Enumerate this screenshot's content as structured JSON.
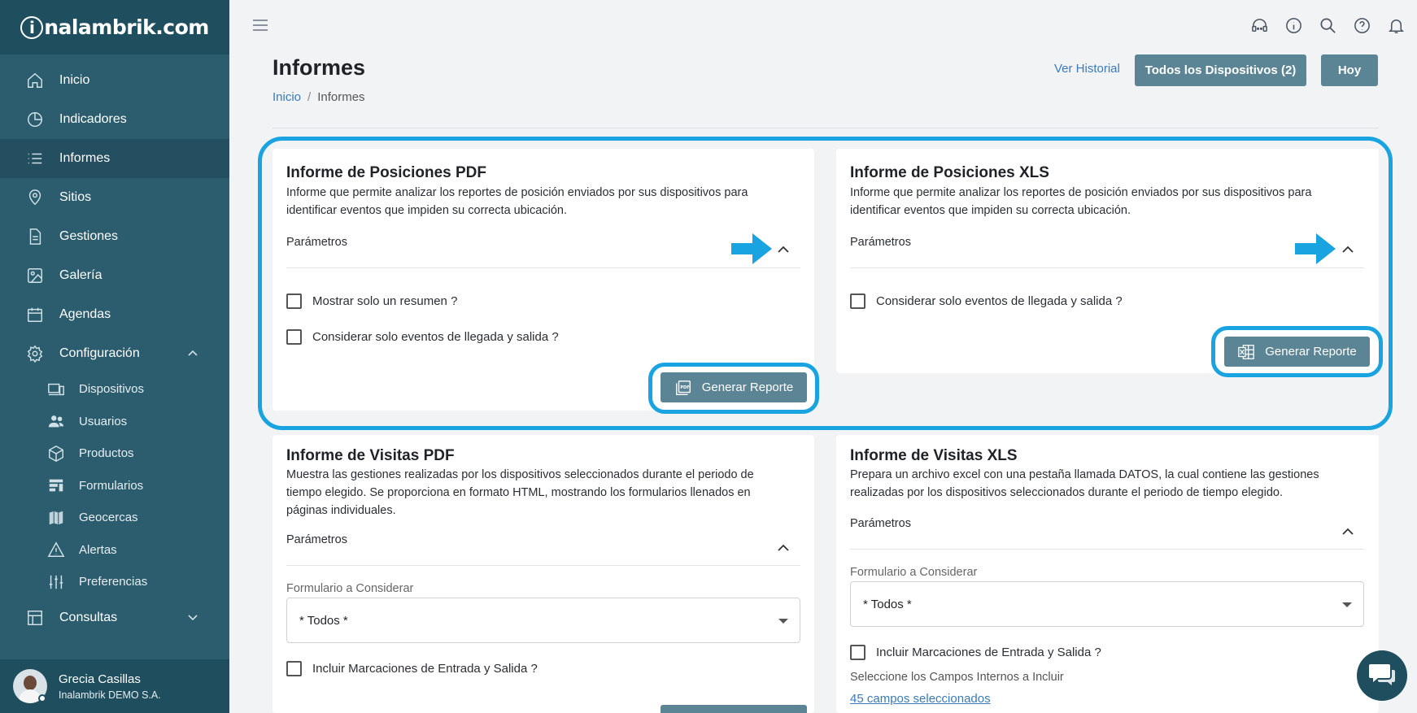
{
  "brand": {
    "logo_text": "nalambrik.com",
    "logo_letter": "i"
  },
  "sidebar": {
    "items": [
      {
        "label": "Inicio",
        "icon": "home-icon"
      },
      {
        "label": "Indicadores",
        "icon": "pie-chart-icon"
      },
      {
        "label": "Informes",
        "icon": "list-icon"
      },
      {
        "label": "Sitios",
        "icon": "map-pin-icon"
      },
      {
        "label": "Gestiones",
        "icon": "document-icon"
      },
      {
        "label": "Galería",
        "icon": "image-icon"
      },
      {
        "label": "Agendas",
        "icon": "calendar-icon"
      },
      {
        "label": "Configuración",
        "icon": "gear-icon"
      }
    ],
    "config_sub": [
      {
        "label": "Dispositivos",
        "icon": "devices-icon"
      },
      {
        "label": "Usuarios",
        "icon": "users-icon"
      },
      {
        "label": "Productos",
        "icon": "box-icon"
      },
      {
        "label": "Formularios",
        "icon": "form-icon"
      },
      {
        "label": "Geocercas",
        "icon": "map-icon"
      },
      {
        "label": "Alertas",
        "icon": "warning-icon"
      },
      {
        "label": "Preferencias",
        "icon": "sliders-icon"
      }
    ],
    "consultas": {
      "label": "Consultas",
      "icon": "table-icon"
    },
    "user": {
      "name": "Grecia Casillas",
      "org": "Inalambrik DEMO S.A."
    }
  },
  "header": {
    "title": "Informes",
    "breadcrumb": {
      "home": "Inicio",
      "sep": "/",
      "current": "Informes"
    },
    "ver_historial": "Ver Historial",
    "devices_button": "Todos los Dispositivos (2)",
    "hoy_button": "Hoy"
  },
  "cards": {
    "pos_pdf": {
      "title": "Informe de Posiciones PDF",
      "desc": "Informe que permite analizar los reportes de posición enviados por sus dispositivos para identificar eventos que impiden su correcta ubicación.",
      "params": "Parámetros",
      "chk1": "Mostrar solo un resumen ?",
      "chk2": "Considerar solo eventos de llegada y salida ?",
      "button": "Generar Reporte"
    },
    "pos_xls": {
      "title": "Informe de Posiciones XLS",
      "desc": "Informe que permite analizar los reportes de posición enviados por sus dispositivos para identificar eventos que impiden su correcta ubicación.",
      "params": "Parámetros",
      "chk1": "Considerar solo eventos de llegada y salida ?",
      "button": "Generar Reporte"
    },
    "vis_pdf": {
      "title": "Informe de Visitas PDF",
      "desc": "Muestra las gestiones realizadas por los dispositivos seleccionados durante el periodo de tiempo elegido. Se proporciona en formato HTML, mostrando los formularios llenados en páginas individuales.",
      "params": "Parámetros",
      "form_label": "Formulario a Considerar",
      "form_value": "* Todos *",
      "chk1": "Incluir Marcaciones de Entrada y Salida ?"
    },
    "vis_xls": {
      "title": "Informe de Visitas XLS",
      "desc": "Prepara un archivo excel con una pestaña llamada DATOS, la cual contiene las gestiones realizadas por los dispositivos seleccionados durante el periodo de tiempo elegido.",
      "params": "Parámetros",
      "form_label": "Formulario a Considerar",
      "form_value": "* Todos *",
      "chk1": "Incluir Marcaciones de Entrada y Salida ?",
      "campos_label": "Seleccione los Campos Internos a Incluir",
      "campos_link": "45 campos seleccionados"
    }
  },
  "colors": {
    "sidebar": "#2b5d6f",
    "button": "#5b8595",
    "highlight": "#19a3e0",
    "link": "#3a7ab8"
  }
}
